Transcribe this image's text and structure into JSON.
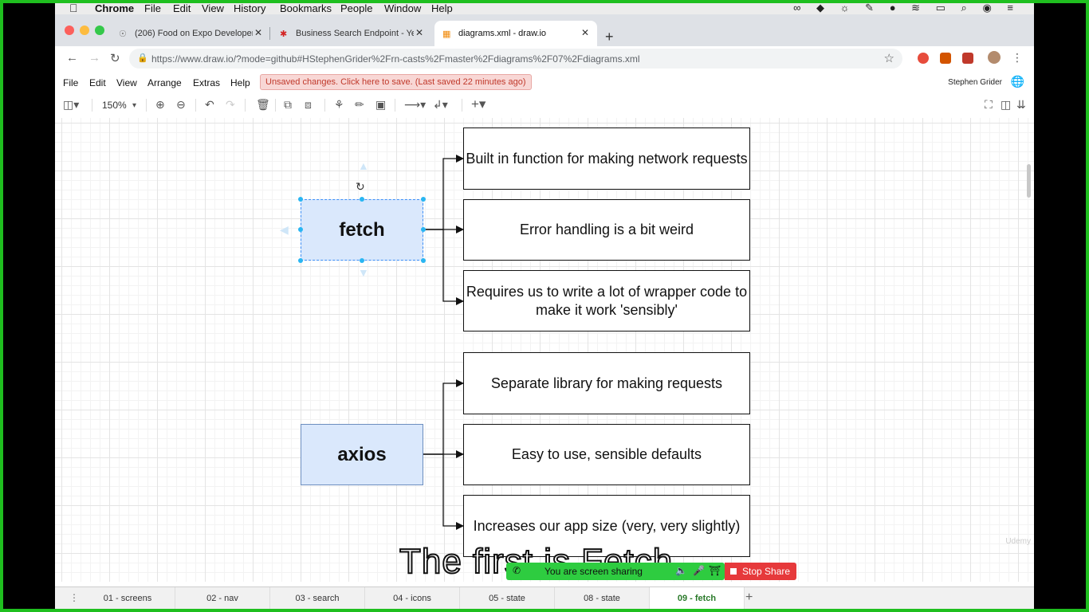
{
  "mac_menubar": {
    "app_name": "Chrome",
    "items": [
      "File",
      "Edit",
      "View",
      "History",
      "Bookmarks",
      "People",
      "Window",
      "Help"
    ],
    "status_icons": "∞ ◆ ☼ ✎ ● ≋ ▭ ⌕ ◉ ≡"
  },
  "browser": {
    "tabs": [
      {
        "title": "(206) Food on Expo Developer",
        "icon": "expo-icon"
      },
      {
        "title": "Business Search Endpoint - Ye",
        "icon": "yelp-icon"
      },
      {
        "title": "diagrams.xml - draw.io",
        "icon": "drawio-icon"
      }
    ],
    "url": "https://www.draw.io/?mode=github#HStephenGrider%2Frn-casts%2Fmaster%2Fdiagrams%2F07%2Fdiagrams.xml"
  },
  "drawio": {
    "menu": [
      "File",
      "Edit",
      "View",
      "Arrange",
      "Extras",
      "Help"
    ],
    "unsaved_notice": "Unsaved changes. Click here to save. (Last saved 22 minutes ago)",
    "user_name": "Stephen Grider",
    "zoom": "150%"
  },
  "diagram": {
    "fetch": {
      "label": "fetch",
      "points": [
        "Built in function for making network requests",
        "Error handling is a bit weird",
        "Requires us to write a lot of wrapper code to make it work 'sensibly'"
      ]
    },
    "axios": {
      "label": "axios",
      "points": [
        "Separate library for making requests",
        "Easy to use, sensible defaults",
        "Increases our app size (very, very slightly)"
      ]
    },
    "colors": {
      "library_fill": "#dae8fc",
      "library_border": "#6c8ebf",
      "selection": "#29b6f2"
    }
  },
  "caption": "The first is Fetch",
  "screen_share": {
    "status": "You are screen sharing",
    "stop_label": "Stop Share"
  },
  "watermark": "Udemy",
  "page_tabs": [
    "01 - screens",
    "02 - nav",
    "03 - search",
    "04 - icons",
    "05 - state",
    "08 - state",
    "09 - fetch"
  ],
  "active_page_tab": "09 - fetch"
}
